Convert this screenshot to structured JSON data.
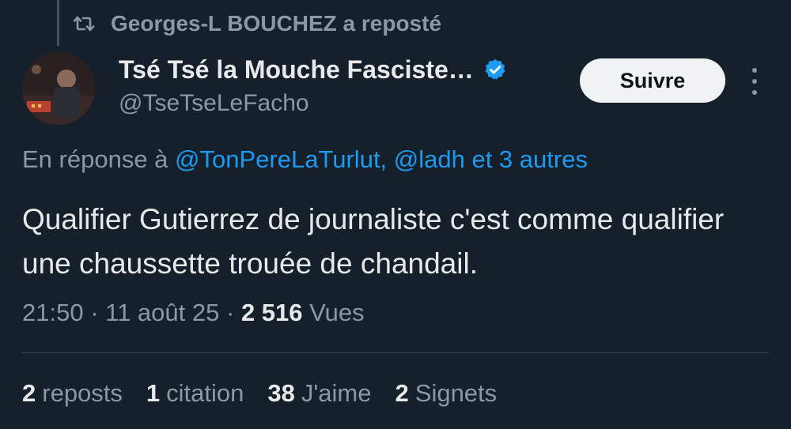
{
  "repost": {
    "text": "Georges-L BOUCHEZ a reposté",
    "icon": "repost-icon"
  },
  "author": {
    "display_name": "Tsé Tsé la Mouche Fasciste…",
    "handle": "@TseTseLeFacho",
    "verified": true,
    "verified_color": "#1d9bf0"
  },
  "follow_label": "Suivre",
  "reply": {
    "prefix": "En réponse à",
    "mentions": "@TonPereLaTurlut, @ladh et 3 autres"
  },
  "tweet_text": "Qualifier Gutierrez de journaliste c'est comme qualifier une chaussette trouée de chandail.",
  "meta": {
    "time": "21:50",
    "date": "11 août 25",
    "views_count": "2 516",
    "views_label": "Vues"
  },
  "stats": [
    {
      "count": "2",
      "label": "reposts"
    },
    {
      "count": "1",
      "label": "citation"
    },
    {
      "count": "38",
      "label": "J'aime"
    },
    {
      "count": "2",
      "label": "Signets"
    }
  ],
  "colors": {
    "background": "#15202b",
    "secondary_text": "#8b98a5",
    "link": "#1d9bf0",
    "primary_text": "#e7e9ea"
  }
}
